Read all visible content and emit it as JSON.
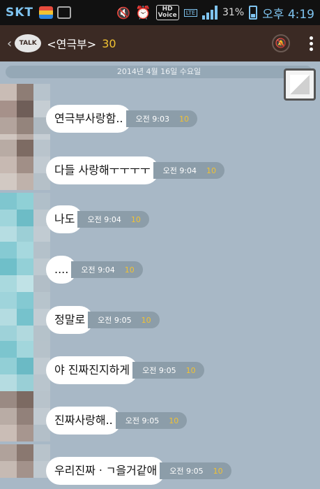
{
  "statusbar": {
    "carrier": "SKT",
    "hd_label": "HD",
    "voice_label": "Voice",
    "lte_label": "LTE",
    "battery": "31%",
    "time": "오후 4:19"
  },
  "header": {
    "talk_icon": "TALK",
    "title": "<연극부>",
    "member_count": "30"
  },
  "chat": {
    "date": "2014년 4월 16일 수요일",
    "messages": [
      {
        "text": "연극부사랑함..",
        "time": "오전 9:03",
        "unread": "10"
      },
      {
        "text": "다들 사랑해ㅜㅜㅜㅜ",
        "time": "오전 9:04",
        "unread": "10"
      },
      {
        "text": "나도",
        "time": "오전 9:04",
        "unread": "10"
      },
      {
        "text": "....",
        "time": "오전 9:04",
        "unread": "10"
      },
      {
        "text": "정말로",
        "time": "오전 9:05",
        "unread": "10"
      },
      {
        "text": "야 진짜진지하게",
        "time": "오전 9:05",
        "unread": "10"
      },
      {
        "text": "진짜사랑해..",
        "time": "오전 9:05",
        "unread": "10"
      },
      {
        "text": "우리진짜ㆍㄱ을거같애",
        "time": "오전 9:05",
        "unread": "10"
      }
    ]
  }
}
